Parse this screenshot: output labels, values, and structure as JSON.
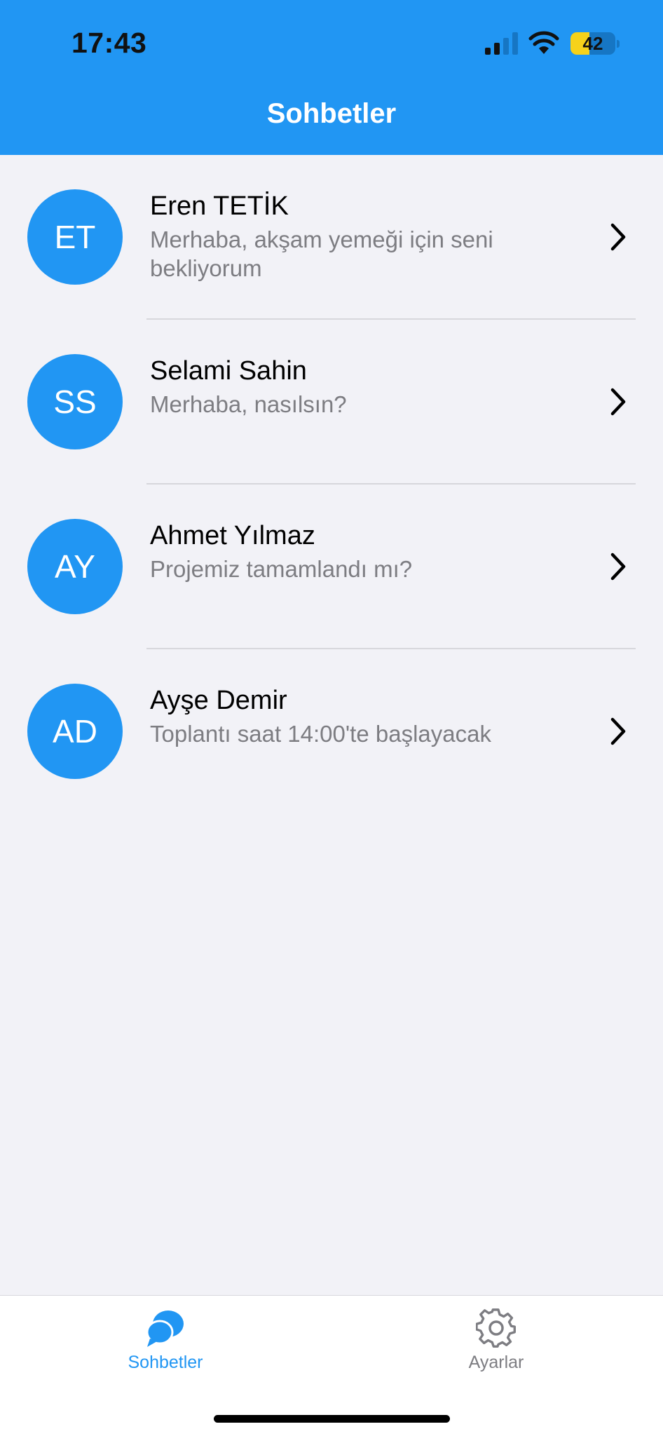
{
  "status_bar": {
    "time": "17:43",
    "battery": "42",
    "battery_level": 0.42,
    "icons": [
      "cellular-signal-icon",
      "wifi-icon",
      "battery-icon"
    ]
  },
  "header": {
    "title": "Sohbetler"
  },
  "chats": [
    {
      "initials": "ET",
      "name": "Eren TETİK",
      "preview": "Merhaba, akşam yemeği için seni bekliyorum"
    },
    {
      "initials": "SS",
      "name": "Selami Sahin",
      "preview": "Merhaba, nasılsın?"
    },
    {
      "initials": "AY",
      "name": "Ahmet Yılmaz",
      "preview": "Projemiz tamamlandı mı?"
    },
    {
      "initials": "AD",
      "name": "Ayşe Demir",
      "preview": "Toplantı saat 14:00'te başlayacak"
    }
  ],
  "tabs": [
    {
      "label": "Sohbetler",
      "icon": "chat-bubbles-icon",
      "active": true
    },
    {
      "label": "Ayarlar",
      "icon": "gear-icon",
      "active": false
    }
  ],
  "colors": {
    "accent": "#2196f3",
    "background": "#f2f2f7",
    "secondary_text": "#7d7d82",
    "battery_fill": "#f6d21b"
  }
}
